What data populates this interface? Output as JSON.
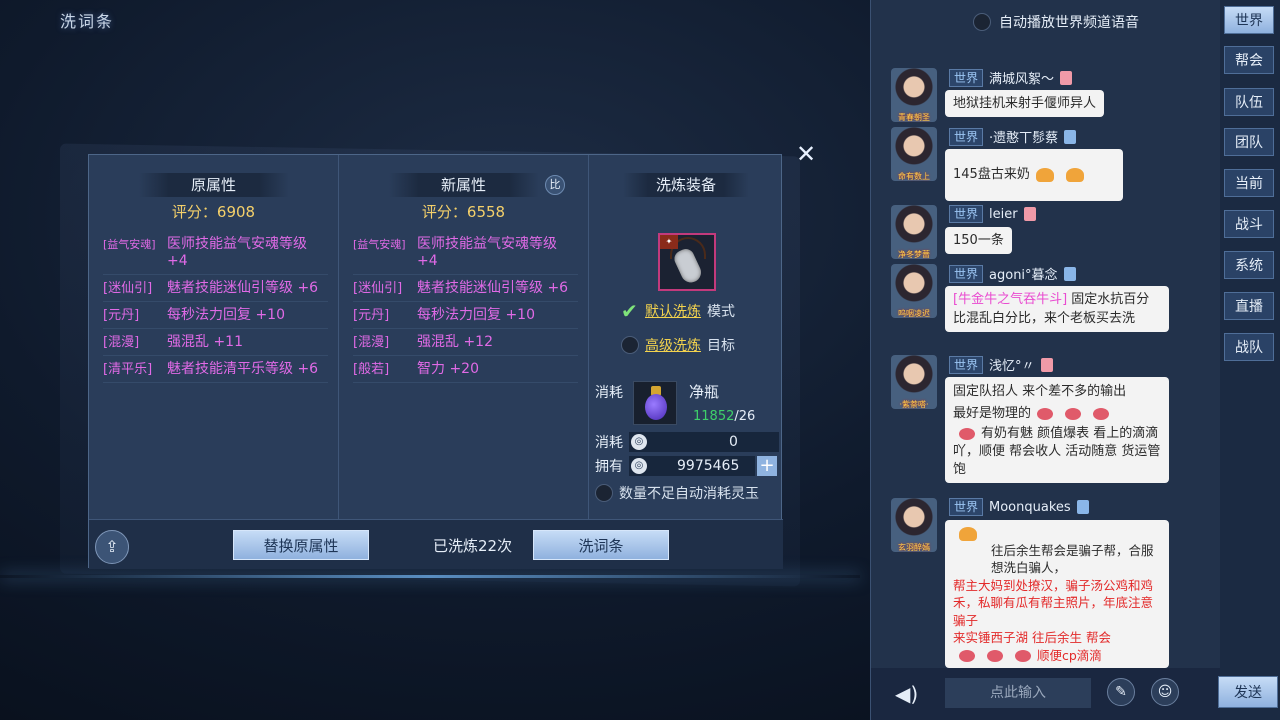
{
  "page_title": "洗词条",
  "orig": {
    "header": "原属性",
    "score_label": "评分：6908",
    "attrs": [
      {
        "tag": "[益气安魂]",
        "desc": "医师技能益气安魂等级 +4"
      },
      {
        "tag": "[迷仙引]",
        "desc": "魅者技能迷仙引等级 +6"
      },
      {
        "tag": "[元丹]",
        "desc": "每秒法力回复 +10"
      },
      {
        "tag": "[混漫]",
        "desc": "强混乱 +11"
      },
      {
        "tag": "[清平乐]",
        "desc": "魅者技能清平乐等级 +6"
      }
    ]
  },
  "new": {
    "header": "新属性",
    "compare_badge": "比",
    "score_label": "评分：6558",
    "attrs": [
      {
        "tag": "[益气安魂]",
        "desc": "医师技能益气安魂等级 +4"
      },
      {
        "tag": "[迷仙引]",
        "desc": "魅者技能迷仙引等级 +6"
      },
      {
        "tag": "[元丹]",
        "desc": "每秒法力回复 +10"
      },
      {
        "tag": "[混漫]",
        "desc": "强混乱 +12"
      },
      {
        "tag": "[般若]",
        "desc": "智力 +20"
      }
    ]
  },
  "equip": {
    "header": "洗炼装备",
    "default_link": "默认洗炼",
    "default_suffix": "模式",
    "advanced_link": "高级洗炼",
    "advanced_suffix": "目标",
    "cost_label": "消耗",
    "material_name": "净瓶",
    "material_have": "11852",
    "material_need": "/26",
    "cost2_label": "消耗",
    "cost2_value": "0",
    "own_label": "拥有",
    "own_value": "9975465",
    "auto_consume_label": "数量不足自动消耗灵玉"
  },
  "footer": {
    "replace_btn": "替换原属性",
    "wash_count": "已洗炼22次",
    "wash_btn": "洗词条"
  },
  "chat": {
    "autoplay_label": "自动播放世界频道语音",
    "channel": "世界",
    "messages": [
      {
        "name": "满城风絮～",
        "gender": "f",
        "avatar_label": "青春朝圣",
        "text": "地狱挂机来射手偃师异人"
      },
      {
        "name": "·遗憨丅髿蔡",
        "gender": "m",
        "avatar_label": "命有数上",
        "text": "145盘古来奶"
      },
      {
        "name": "leier",
        "gender": "f",
        "avatar_label": "净冬梦蔷",
        "text": "150一条"
      },
      {
        "name": "agoni°暮念",
        "gender": "m",
        "avatar_label": "呜咽凌迟",
        "pink": "[牛金牛之气吞牛斗]",
        "text": " 固定水抗百分比混乱白分比，来个老板买去洗"
      },
      {
        "name": "浅忆°〃",
        "gender": "f",
        "avatar_label": "·紫萘嗒·",
        "line1": "固定队招人 来个差不多的输出",
        "line2": "最好是物理的",
        "line3": "有奶有魅 颜值爆表 看上的滴滴吖，顺便 帮会收人 活动随意 货运管饱"
      },
      {
        "name": "Moonquakes",
        "gender": "m",
        "avatar_label": "玄羽醉嫣",
        "line1": "往后余生帮会是骗子帮，合服想洗白骗人，",
        "red1": "帮主大妈到处撩汉，骗子汤公鸡和鸡禾，私聊有瓜有帮主照片，年底注意骗子",
        "line2": "来实锤西子湖 往后余生 帮会",
        "red2": "顺便cp滴滴"
      }
    ],
    "input_placeholder": "点此输入",
    "send_btn": "发送"
  },
  "tabs": [
    "世界",
    "帮会",
    "队伍",
    "团队",
    "当前",
    "战斗",
    "系统",
    "直播",
    "战队"
  ]
}
